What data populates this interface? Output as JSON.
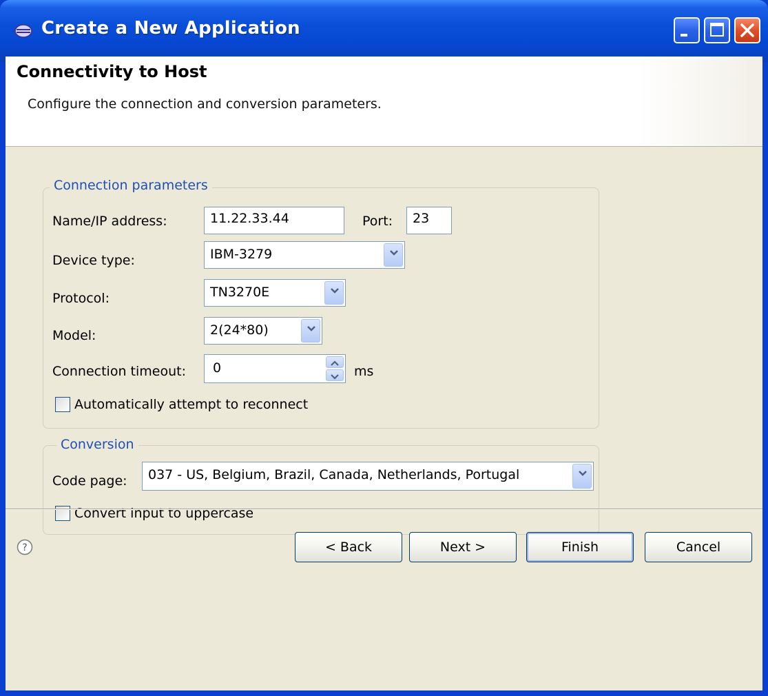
{
  "window": {
    "title": "Create a New Application"
  },
  "header": {
    "title": "Connectivity to Host",
    "description": "Configure the connection and conversion parameters."
  },
  "connection": {
    "legend": "Connection parameters",
    "name_ip_label": "Name/IP address:",
    "name_ip_value": "11.22.33.44",
    "port_label": "Port:",
    "port_value": "23",
    "device_type_label": "Device type:",
    "device_type_value": "IBM-3279",
    "protocol_label": "Protocol:",
    "protocol_value": "TN3270E",
    "model_label": "Model:",
    "model_value": "2(24*80)",
    "timeout_label": "Connection timeout:",
    "timeout_value": "0",
    "timeout_unit": "ms",
    "reconnect_label": "Automatically attempt to reconnect",
    "reconnect_checked": false
  },
  "conversion": {
    "legend": "Conversion",
    "code_page_label": "Code page:",
    "code_page_value": "037 - US, Belgium, Brazil, Canada, Netherlands, Portugal",
    "uppercase_label": "Convert input to uppercase",
    "uppercase_checked": false
  },
  "footer": {
    "back_label": "< Back",
    "next_label": "Next >",
    "finish_label": "Finish",
    "cancel_label": "Cancel"
  },
  "colors": {
    "titlebar": "#0a4fd8",
    "dialog_bg": "#ece9d8",
    "group_legend": "#1f4fb6"
  }
}
